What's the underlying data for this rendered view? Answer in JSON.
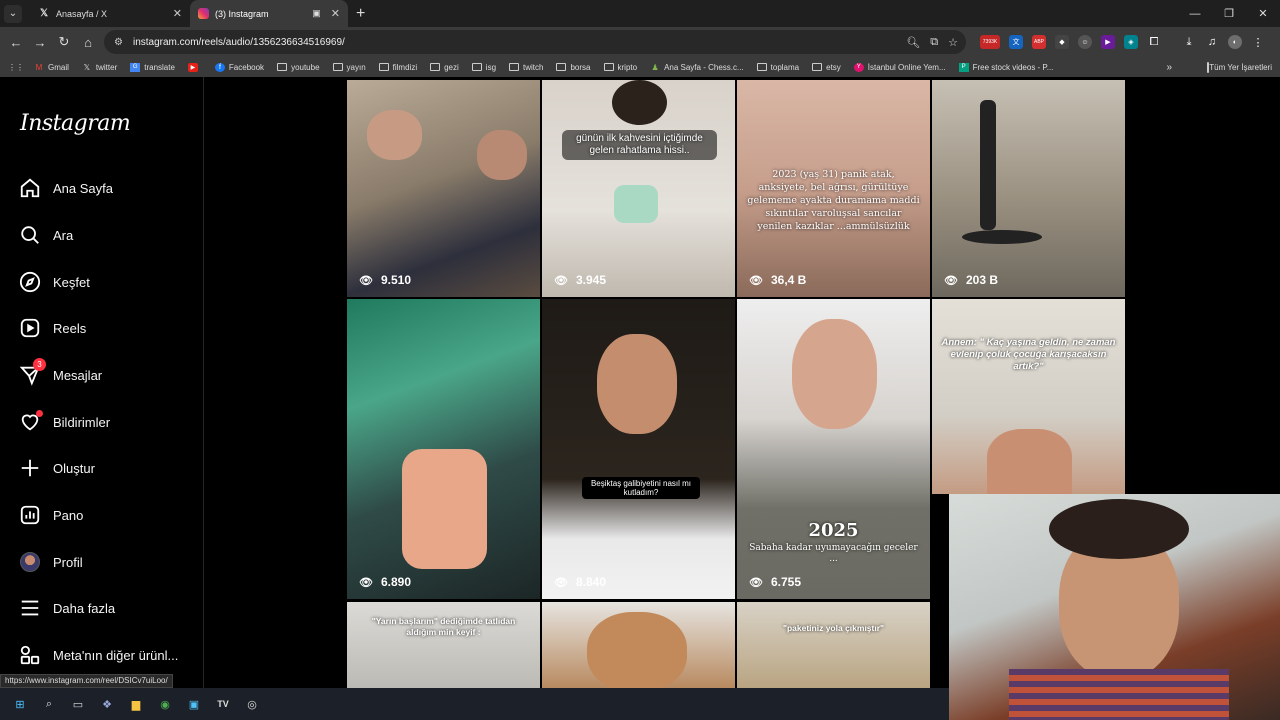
{
  "browser": {
    "tabs": [
      {
        "title": "Anasayfa / X",
        "favicon": "x-logo-icon",
        "active": false
      },
      {
        "title": "(3) Instagram",
        "favicon": "instagram-icon",
        "active": true
      }
    ],
    "new_tab": "+",
    "url": "instagram.com/reels/audio/1356236634516969/",
    "status_url": "https://www.instagram.com/reel/DSICv7uiLoo/",
    "ext_badge": "7393K"
  },
  "bookmarks": [
    {
      "label": "Gmail",
      "icon": "gmail-icon"
    },
    {
      "label": "twitter",
      "icon": "x-logo-icon"
    },
    {
      "label": "translate",
      "icon": "translate-icon"
    },
    {
      "label": "",
      "icon": "youtube-icon"
    },
    {
      "label": "Facebook",
      "icon": "facebook-icon"
    },
    {
      "label": "youtube",
      "icon": "folder-icon"
    },
    {
      "label": "yayın",
      "icon": "folder-icon"
    },
    {
      "label": "filmdizi",
      "icon": "folder-icon"
    },
    {
      "label": "gezi",
      "icon": "folder-icon"
    },
    {
      "label": "isg",
      "icon": "folder-icon"
    },
    {
      "label": "twitch",
      "icon": "folder-icon"
    },
    {
      "label": "borsa",
      "icon": "folder-icon"
    },
    {
      "label": "kripto",
      "icon": "folder-icon"
    },
    {
      "label": "Ana Sayfa - Chess.c...",
      "icon": "chess-icon"
    },
    {
      "label": "toplama",
      "icon": "folder-icon"
    },
    {
      "label": "etsy",
      "icon": "folder-icon"
    },
    {
      "label": "İstanbul Online Yem...",
      "icon": "y-icon"
    },
    {
      "label": "Free stock videos - P...",
      "icon": "pexels-icon"
    }
  ],
  "bookmarks_all": "Tüm Yer İşaretleri",
  "instagram": {
    "logo": "Instagram",
    "nav": [
      {
        "label": "Ana Sayfa",
        "icon": "home-icon"
      },
      {
        "label": "Ara",
        "icon": "search-icon"
      },
      {
        "label": "Keşfet",
        "icon": "compass-icon"
      },
      {
        "label": "Reels",
        "icon": "reels-icon"
      },
      {
        "label": "Mesajlar",
        "icon": "messenger-icon",
        "badge": "3"
      },
      {
        "label": "Bildirimler",
        "icon": "heart-icon",
        "dot": true
      },
      {
        "label": "Oluştur",
        "icon": "plus-icon"
      },
      {
        "label": "Pano",
        "icon": "dashboard-icon"
      },
      {
        "label": "Profil",
        "icon": "avatar"
      },
      {
        "label": "Daha fazla",
        "icon": "menu-icon"
      },
      {
        "label": "Meta'nın diğer ürünl...",
        "icon": "meta-apps-icon"
      }
    ],
    "reels": [
      {
        "views": "9.510",
        "text": "",
        "bg": "#9b8f7f"
      },
      {
        "views": "3.945",
        "text": "günün ilk kahvesini içtiğimde gelen rahatlama hissi..",
        "bg": "#c9c2b8"
      },
      {
        "views": "36,4 B",
        "text": "2023 (yaş 31) panik atak, anksiyete, bel ağrısı, gürültüye gelememe ayakta duramama maddi sıkıntılar varoluşsal sancılar yenilen kazıklar ...ammülsüzlük",
        "bg": "#c9a898"
      },
      {
        "views": "203 B",
        "text": "",
        "bg": "#8a8478"
      },
      {
        "views": "6.890",
        "text": "",
        "bg": "#3f6a5d"
      },
      {
        "views": "8.840",
        "text": "Beşiktaş galibiyetini nasıl mı kutladım?",
        "bg": "#2a241e"
      },
      {
        "views": "6.755",
        "text": "2025",
        "subtext": "Sabaha kadar uyumayacağın geceler ...",
        "bg": "#8a8a84"
      },
      {
        "views": "",
        "text": "Annem: \" Kaç yaşına geldin, ne zaman evlenip çoluk çocuğa karışacaksın artık?\"",
        "bg": "#d8d4cc"
      },
      {
        "views": "",
        "text": "\"Yarın başlarım\" dediğimde tatlıdan aldığım min keyif :",
        "bg": "#c8c6c2"
      },
      {
        "views": "",
        "text": "",
        "bg": "#b0a89c"
      },
      {
        "views": "",
        "text": "\"paketiniz yola çıkmıştır\"",
        "bg": "#d2cdc5"
      }
    ]
  },
  "taskbar": [
    "windows-start-icon",
    "search-icon",
    "task-view-icon",
    "copilot-icon",
    "folder-icon",
    "chrome-icon",
    "app-icon",
    "tradingview-icon",
    "obs-icon"
  ]
}
